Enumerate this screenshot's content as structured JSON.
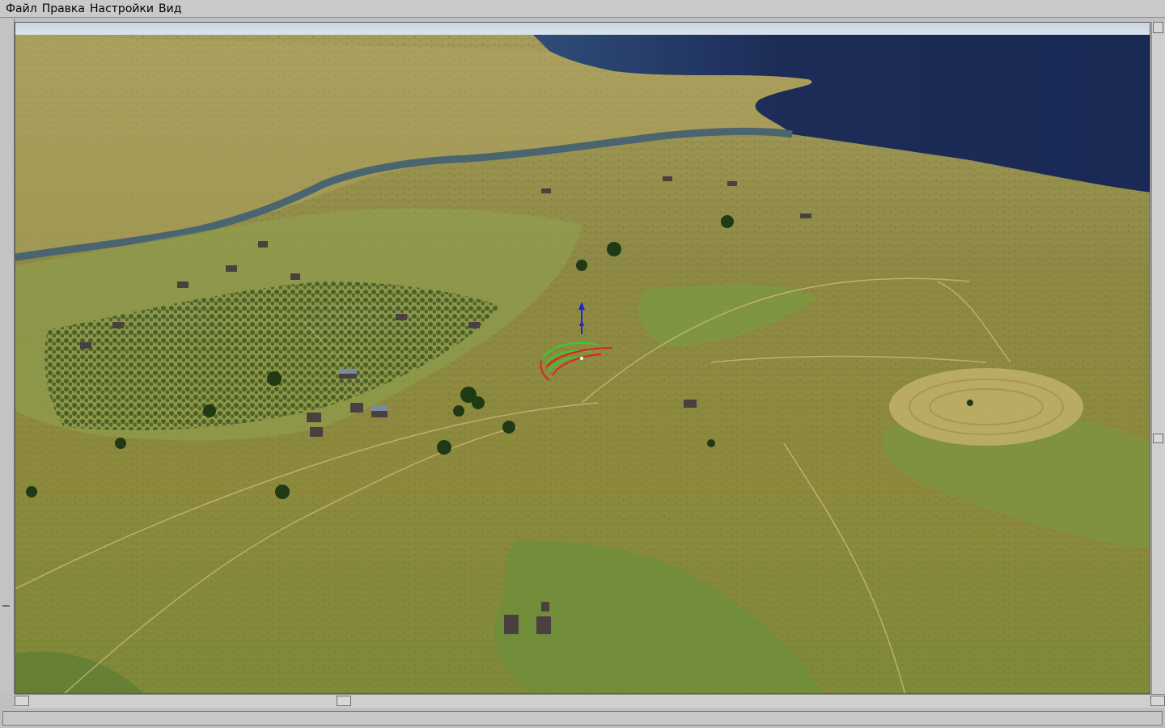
{
  "menu": {
    "file": "Файл",
    "edit": "Правка",
    "settings": "Настройки",
    "view": "Вид"
  },
  "colors": {
    "sea": "#1f2f5c",
    "river": "#4a6470",
    "terrain_light": "#a79a4e",
    "terrain_green": "#6f8b3a",
    "gizmo_green": "#2fd12f",
    "gizmo_red": "#e02020",
    "gizmo_blue": "#2020e0"
  },
  "scene": {
    "icons": [
      "translate-gizmo-icon",
      "rotate-gizmo-icon"
    ]
  }
}
